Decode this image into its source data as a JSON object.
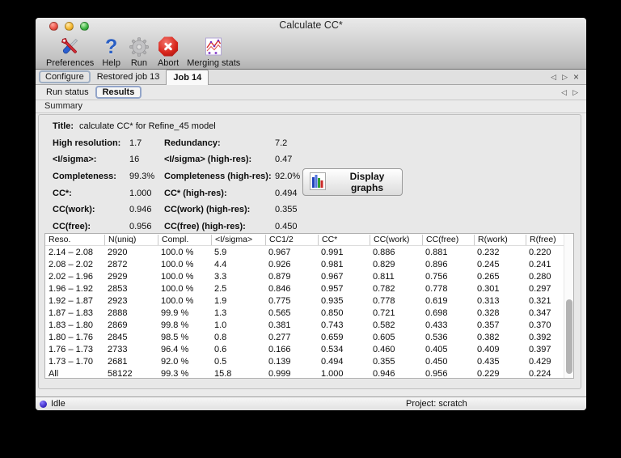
{
  "window": {
    "title": "Calculate CC*"
  },
  "toolbar": {
    "items": [
      {
        "label": "Preferences",
        "icon": "preferences-tools-icon"
      },
      {
        "label": "Help",
        "icon": "help-question-icon"
      },
      {
        "label": "Run",
        "icon": "run-gear-icon"
      },
      {
        "label": "Abort",
        "icon": "abort-stop-icon"
      },
      {
        "label": "Merging stats",
        "icon": "merging-stats-chart-icon"
      }
    ]
  },
  "tabs": {
    "main": [
      {
        "label": "Configure"
      },
      {
        "label": "Restored job 13"
      },
      {
        "label": "Job 14"
      }
    ],
    "sub": [
      {
        "label": "Run status"
      },
      {
        "label": "Results"
      }
    ],
    "nav": {
      "prev": "◁",
      "next": "▷",
      "close": "×"
    }
  },
  "section": {
    "header": "Summary"
  },
  "summary": {
    "title_label": "Title:",
    "title_value": "calculate CC* for Refine_45 model",
    "rows": [
      {
        "label1": "High resolution:",
        "value1": "1.7",
        "label2": "Redundancy:",
        "value2": "7.2"
      },
      {
        "label1": "<I/sigma>:",
        "value1": "16",
        "label2": "<I/sigma> (high-res):",
        "value2": "0.47"
      },
      {
        "label1": "Completeness:",
        "value1": "99.3%",
        "label2": "Completeness (high-res):",
        "value2": "92.0%"
      },
      {
        "label1": "CC*:",
        "value1": "1.000",
        "label2": "CC* (high-res):",
        "value2": "0.494"
      },
      {
        "label1": "CC(work):",
        "value1": "0.946",
        "label2": "CC(work) (high-res):",
        "value2": "0.355"
      },
      {
        "label1": "CC(free):",
        "value1": "0.956",
        "label2": "CC(free) (high-res):",
        "value2": "0.450"
      }
    ],
    "display_graphs_button": "Display graphs"
  },
  "table": {
    "headers": [
      "Reso.",
      "N(uniq)",
      "Compl.",
      "<I/sigma>",
      "CC1/2",
      "CC*",
      "CC(work)",
      "CC(free)",
      "R(work)",
      "R(free)"
    ],
    "rows": [
      [
        "2.14 – 2.08",
        "2920",
        "100.0 %",
        "5.9",
        "0.967",
        "0.991",
        "0.886",
        "0.881",
        "0.232",
        "0.220"
      ],
      [
        "2.08 – 2.02",
        "2872",
        "100.0 %",
        "4.4",
        "0.926",
        "0.981",
        "0.829",
        "0.896",
        "0.245",
        "0.241"
      ],
      [
        "2.02 – 1.96",
        "2929",
        "100.0 %",
        "3.3",
        "0.879",
        "0.967",
        "0.811",
        "0.756",
        "0.265",
        "0.280"
      ],
      [
        "1.96 – 1.92",
        "2853",
        "100.0 %",
        "2.5",
        "0.846",
        "0.957",
        "0.782",
        "0.778",
        "0.301",
        "0.297"
      ],
      [
        "1.92 – 1.87",
        "2923",
        "100.0 %",
        "1.9",
        "0.775",
        "0.935",
        "0.778",
        "0.619",
        "0.313",
        "0.321"
      ],
      [
        "1.87 – 1.83",
        "2888",
        "99.9 %",
        "1.3",
        "0.565",
        "0.850",
        "0.721",
        "0.698",
        "0.328",
        "0.347"
      ],
      [
        "1.83 – 1.80",
        "2869",
        "99.8 %",
        "1.0",
        "0.381",
        "0.743",
        "0.582",
        "0.433",
        "0.357",
        "0.370"
      ],
      [
        "1.80 – 1.76",
        "2845",
        "98.5 %",
        "0.8",
        "0.277",
        "0.659",
        "0.605",
        "0.536",
        "0.382",
        "0.392"
      ],
      [
        "1.76 – 1.73",
        "2733",
        "96.4 %",
        "0.6",
        "0.166",
        "0.534",
        "0.460",
        "0.405",
        "0.409",
        "0.397"
      ],
      [
        "1.73 – 1.70",
        "2681",
        "92.0 %",
        "0.5",
        "0.139",
        "0.494",
        "0.355",
        "0.450",
        "0.435",
        "0.429"
      ],
      [
        "All",
        "58122",
        "99.3 %",
        "15.8",
        "0.999",
        "1.000",
        "0.946",
        "0.956",
        "0.229",
        "0.224"
      ]
    ]
  },
  "statusbar": {
    "status": "Idle",
    "project": "Project: scratch"
  },
  "colors": {
    "status_dot": "#4433cc",
    "traffic_red": "#eb5247",
    "traffic_yellow": "#f5b72e",
    "traffic_green": "#3db544",
    "help_blue": "#2a5fc4",
    "abort_red": "#d8251b",
    "active_tab_bg": "#fafafa"
  }
}
